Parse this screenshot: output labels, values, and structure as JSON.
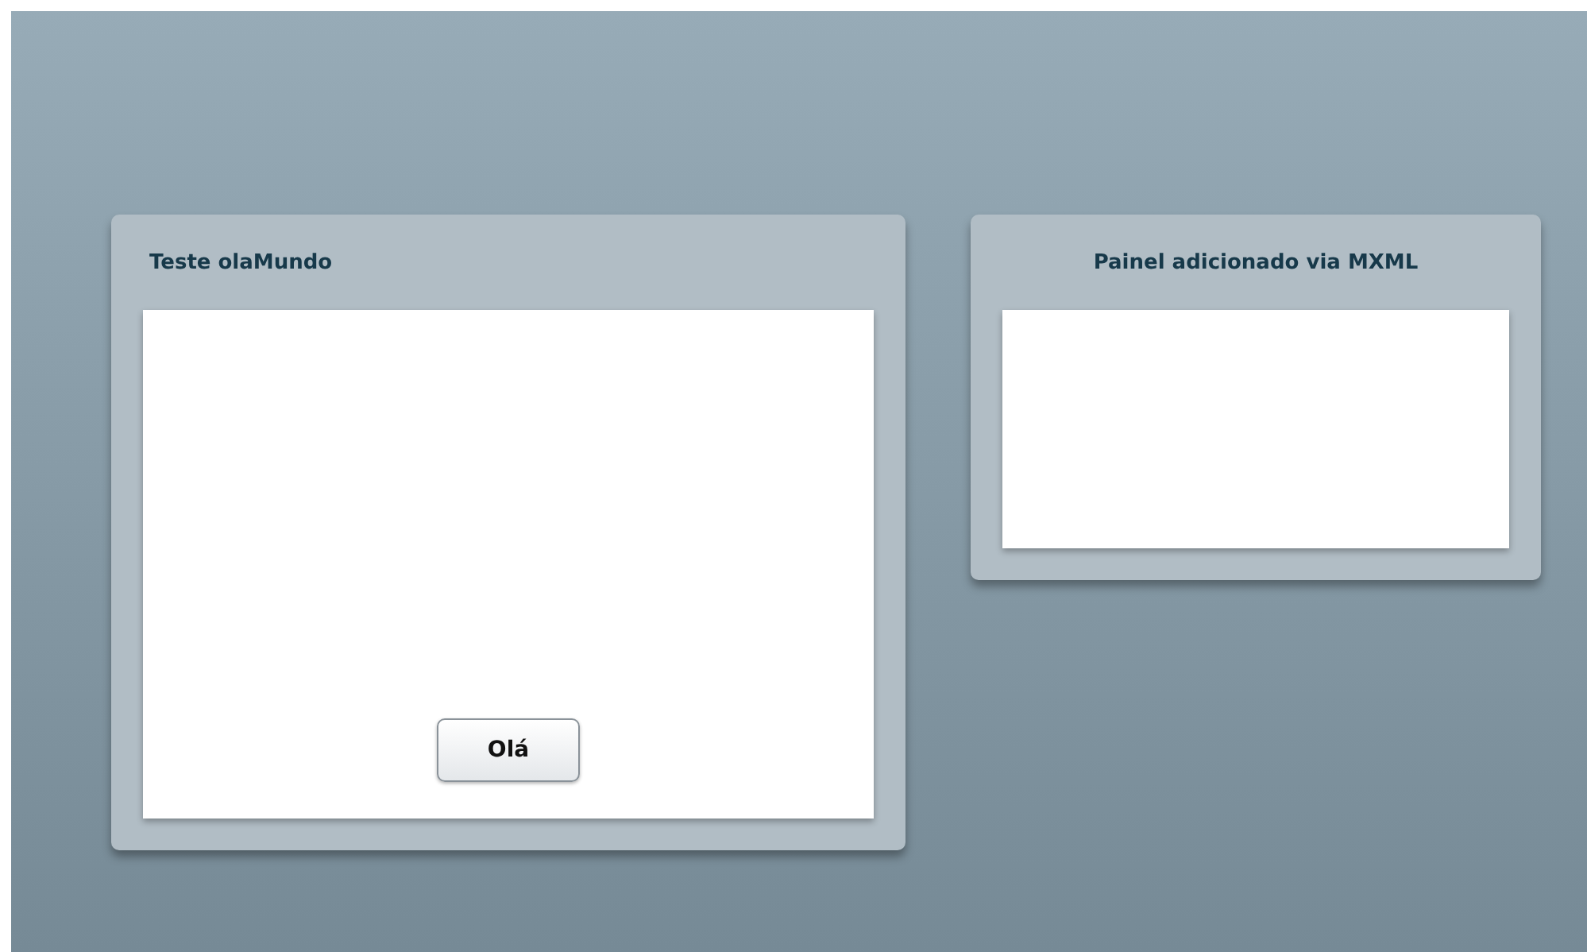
{
  "panels": [
    {
      "title": "Teste olaMundo",
      "buttons": [
        "Olá"
      ]
    },
    {
      "title": "Painel adicionado via MXML"
    }
  ]
}
